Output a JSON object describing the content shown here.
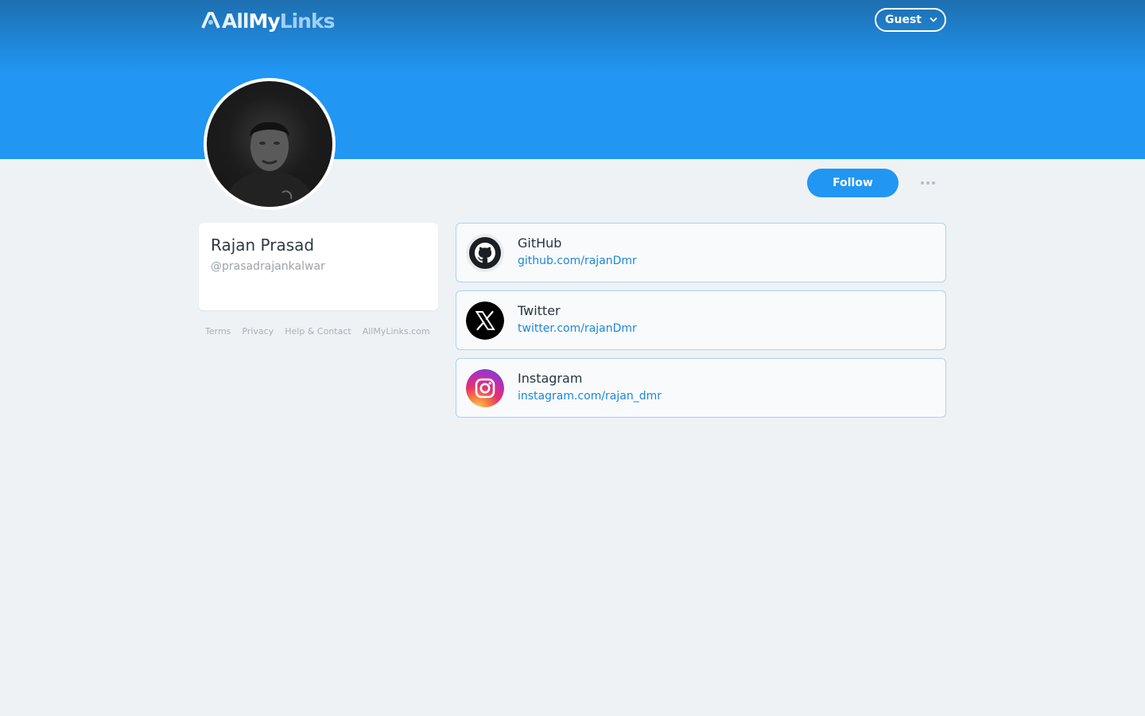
{
  "header": {
    "logo": {
      "part1": "All",
      "part2": "My",
      "part3": "Links"
    },
    "guest_menu": {
      "label": "Guest"
    }
  },
  "profile": {
    "name": "Rajan Prasad",
    "handle": "@prasadrajankalwar",
    "follow_label": "Follow"
  },
  "footer": {
    "links": [
      "Terms",
      "Privacy",
      "Help & Contact",
      "AllMyLinks.com"
    ]
  },
  "links": [
    {
      "title": "GitHub",
      "url": "github.com/rajanDmr",
      "icon": "github-icon"
    },
    {
      "title": "Twitter",
      "url": "twitter.com/rajanDmr",
      "icon": "x-icon"
    },
    {
      "title": "Instagram",
      "url": "instagram.com/rajan_dmr",
      "icon": "instagram-icon"
    }
  ],
  "colors": {
    "banner": "#2196f3",
    "accent": "#2196f3",
    "link_url": "#1e88d6",
    "page_bg": "#eef2f5"
  }
}
